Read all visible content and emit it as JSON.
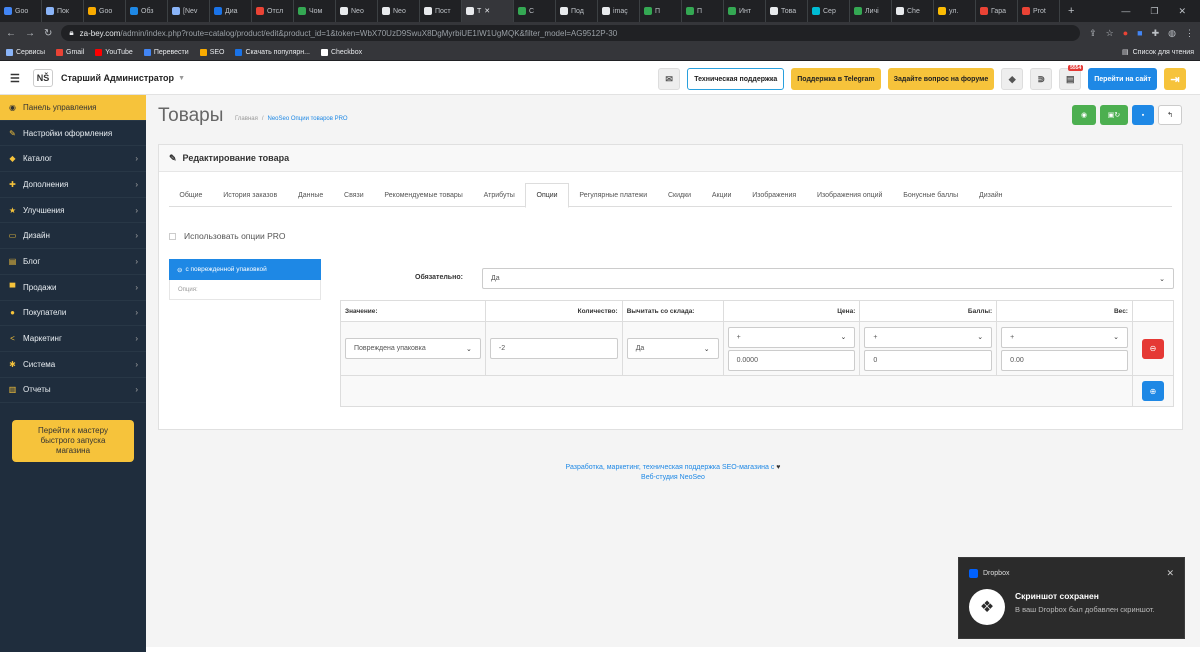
{
  "browser": {
    "tabs": [
      {
        "title": "Goo",
        "color": "#4285f4"
      },
      {
        "title": "Пок",
        "color": "#8ab4f8"
      },
      {
        "title": "Goo",
        "color": "#f9ab00"
      },
      {
        "title": "Обз",
        "color": "#1e88e5"
      },
      {
        "title": "[Nev",
        "color": "#8ab4f8"
      },
      {
        "title": "Диа",
        "color": "#1a73e8"
      },
      {
        "title": "Отсл",
        "color": "#ea4335"
      },
      {
        "title": "Чом",
        "color": "#34a853"
      },
      {
        "title": "Neo",
        "color": "#e8eaed"
      },
      {
        "title": "Neo",
        "color": "#e8eaed"
      },
      {
        "title": "Пост",
        "color": "#e8eaed"
      },
      {
        "title": "Т",
        "color": "#e8eaed",
        "active": true
      },
      {
        "title": "С",
        "color": "#34a853"
      },
      {
        "title": "Под",
        "color": "#e8eaed"
      },
      {
        "title": "imaç",
        "color": "#e8eaed"
      },
      {
        "title": "П",
        "color": "#34a853"
      },
      {
        "title": "П",
        "color": "#34a853"
      },
      {
        "title": "Инт",
        "color": "#34a853"
      },
      {
        "title": "Това",
        "color": "#e8eaed"
      },
      {
        "title": "Сер",
        "color": "#00bcd4"
      },
      {
        "title": "Личі",
        "color": "#34a853"
      },
      {
        "title": "Che",
        "color": "#e8eaed"
      },
      {
        "title": "ул.",
        "color": "#fbbc04"
      },
      {
        "title": "Гара",
        "color": "#ea4335"
      },
      {
        "title": "Prot",
        "color": "#ea4335"
      }
    ],
    "url_host": "za-bey.com",
    "url_path": "/admin/index.php?route=catalog/product/edit&product_id=1&token=WbX70UzD9SwuX8DgMyrbiUE1IW1UgMQK&filter_model=AG9512P-30",
    "bookmarks": [
      {
        "label": "Сервисы",
        "color": "#8ab4f8"
      },
      {
        "label": "Gmail",
        "color": "#ea4335"
      },
      {
        "label": "YouTube",
        "color": "#ff0000"
      },
      {
        "label": "Перевести",
        "color": "#4285f4"
      },
      {
        "label": "SEO",
        "color": "#f9ab00"
      },
      {
        "label": "Скачать популярн...",
        "color": "#1a73e8"
      },
      {
        "label": "Checkbox",
        "color": "#ffffff"
      }
    ],
    "reading_list": "Список для чтения"
  },
  "topbar": {
    "logo": "NŠ",
    "admin_name": "Старший Администратор",
    "buttons": {
      "support": "Техническая поддержка",
      "telegram": "Поддержка в Telegram",
      "forum": "Задайте вопрос на форуме",
      "site": "Перейти на сайт",
      "badge": "5554"
    }
  },
  "sidebar": {
    "items": [
      {
        "label": "Панель управления",
        "icon": "dashboard-icon",
        "glyph": "◉",
        "active": true,
        "arrow": false
      },
      {
        "label": "Настройки оформления",
        "icon": "brush-icon",
        "glyph": "✎",
        "arrow": false
      },
      {
        "label": "Каталог",
        "icon": "tag-icon",
        "glyph": "◆",
        "arrow": true
      },
      {
        "label": "Дополнения",
        "icon": "puzzle-icon",
        "glyph": "✚",
        "arrow": true
      },
      {
        "label": "Улучшения",
        "icon": "star-icon",
        "glyph": "★",
        "arrow": true
      },
      {
        "label": "Дизайн",
        "icon": "monitor-icon",
        "glyph": "▭",
        "arrow": true
      },
      {
        "label": "Блог",
        "icon": "blog-icon",
        "glyph": "▤",
        "arrow": true
      },
      {
        "label": "Продажи",
        "icon": "cart-icon",
        "glyph": "▀",
        "arrow": true
      },
      {
        "label": "Покупатели",
        "icon": "user-icon",
        "glyph": "●",
        "arrow": true
      },
      {
        "label": "Маркетинг",
        "icon": "share-icon",
        "glyph": "<",
        "arrow": true
      },
      {
        "label": "Система",
        "icon": "gear-icon",
        "glyph": "✱",
        "arrow": true
      },
      {
        "label": "Отчеты",
        "icon": "chart-icon",
        "glyph": "▥",
        "arrow": true
      }
    ],
    "wizard": "Перейти к мастеру быстрого запуска магазина"
  },
  "page": {
    "title": "Товары",
    "breadcrumb_home": "Главная",
    "breadcrumb_sep": "/",
    "breadcrumb_current": "NeoSeo Опции товаров PRO",
    "panel_title": "Редактирование товара",
    "tabs": [
      "Общие",
      "История заказов",
      "Данные",
      "Связи",
      "Рекомендуемые товары",
      "Атрибуты",
      "Опции",
      "Регулярные платежи",
      "Скидки",
      "Акции",
      "Изображения",
      "Изображения опций",
      "Бонусные баллы",
      "Дизайн"
    ],
    "active_tab": 6,
    "use_pro_label": "Использовать опции PRO",
    "option_name": "с поврежденной упаковкой",
    "option_sub": "Опция:",
    "required_label": "Обязательно:",
    "required_value": "Да",
    "table": {
      "headers": {
        "value": "Значение:",
        "quantity": "Количество:",
        "subtract": "Вычитать со склада:",
        "price": "Цена:",
        "points": "Баллы:",
        "weight": "Вес:"
      },
      "row": {
        "value": "Повреждена упаковка",
        "quantity": "-2",
        "subtract": "Да",
        "price_prefix": "+",
        "price": "0.0000",
        "points_prefix": "+",
        "points": "0",
        "weight_prefix": "+",
        "weight": "0.00"
      }
    }
  },
  "footer": {
    "line1": "Разработка, маркетинг, техническая поддержка SEO-магазина с",
    "line2": "Веб-студия NeoSeo"
  },
  "toast": {
    "app": "Dropbox",
    "title": "Скриншот сохранен",
    "text": "В ваш Dropbox был добавлен скриншот."
  }
}
